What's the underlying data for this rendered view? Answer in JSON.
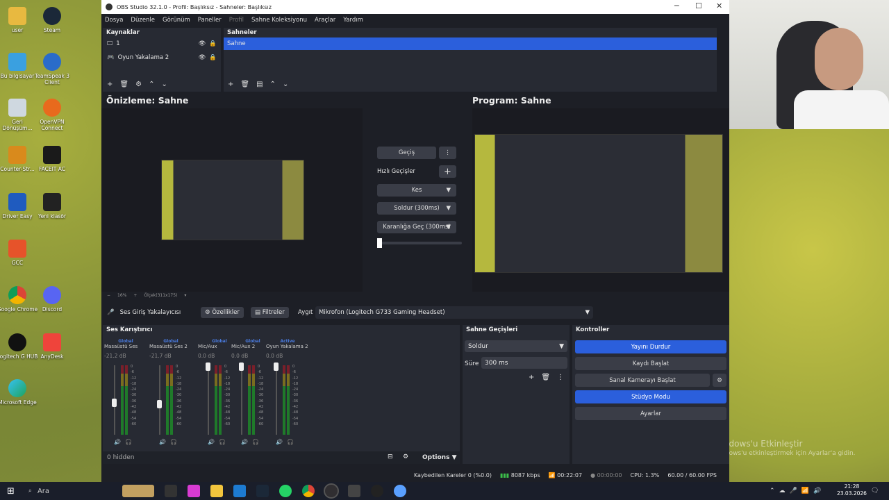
{
  "window": {
    "title": "OBS Studio 32.1.0 - Profil: Başlıksız - Sahneler: Başlıksız",
    "min": "─",
    "max": "☐",
    "close": "✕"
  },
  "menu": [
    "Dosya",
    "Düzenle",
    "Görünüm",
    "Paneller",
    "Profil",
    "Sahne Koleksiyonu",
    "Araçlar",
    "Yardım"
  ],
  "sources": {
    "title": "Kaynaklar",
    "items": [
      {
        "icon": "monitor-icon",
        "label": "1"
      },
      {
        "icon": "gamepad-icon",
        "label": "Oyun Yakalama 2"
      }
    ]
  },
  "scenes": {
    "title": "Sahneler",
    "items": [
      "Sahne"
    ]
  },
  "preview": {
    "title": "Önizleme: Sahne",
    "zoom": "16%",
    "size": "Ölçek(311x175)"
  },
  "program": {
    "title": "Program: Sahne"
  },
  "transitions": {
    "gecis": "Geçiş",
    "quick": "Hızlı Geçişler",
    "cut": "Kes",
    "fade": "Soldur (300ms)",
    "fade_black": "Karanlığa Geç (300ms)"
  },
  "audio_capture": {
    "label": "Ses Giriş Yakalayıcısı",
    "props": "Özellikler",
    "filters": "Filtreler",
    "device_label": "Aygıt",
    "device": "Mikrofon (Logitech G733 Gaming Headset)"
  },
  "mixer": {
    "title": "Ses Karıştırıcı",
    "hidden": "0 hidden",
    "options": "Options",
    "channels": [
      {
        "head": "Global",
        "name": "Masaüstü Ses",
        "db": "-21.2 dB",
        "level": 0.46
      },
      {
        "head": "Global",
        "name": "Masaüstü Ses 2",
        "db": "-21.7 dB",
        "level": 0.44
      },
      {
        "head": "Global",
        "name": "Mic/Aux",
        "db": "0.0 dB",
        "level": 0.98
      },
      {
        "head": "Global",
        "name": "Mic/Aux 2",
        "db": "0.0 dB",
        "level": 0.98
      },
      {
        "head": "Active",
        "name": "Oyun Yakalama 2",
        "db": "0.0 dB",
        "level": 0.98
      }
    ],
    "ticks": [
      "0",
      "-6",
      "-12",
      "-18",
      "-24",
      "-30",
      "-36",
      "-42",
      "-48",
      "-54",
      "-60"
    ]
  },
  "scene_transitions": {
    "title": "Sahne Geçişleri",
    "type": "Soldur",
    "duration_label": "Süre",
    "duration": "300 ms"
  },
  "controls": {
    "title": "Kontroller",
    "stop_stream": "Yayını Durdur",
    "record": "Kaydı Başlat",
    "vcam": "Sanal Kamerayı Başlat",
    "studio": "Stüdyo Modu",
    "settings": "Ayarlar"
  },
  "status": {
    "dropped": "Kaybedilen Kareler 0 (%0.0)",
    "kbps": "8087 kbps",
    "stream_time": "00:22:07",
    "rec_time": "00:00:00",
    "cpu": "CPU: 1.3%",
    "fps": "60.00 / 60.00 FPS"
  },
  "desktop_icons": [
    "user",
    "Steam",
    "Bu bilgisayar",
    "TeamSpeak 3 Client",
    "Geri Dönüşüm...",
    "OpenVPN Connect",
    "Counter-Str...",
    "FACEIT AC",
    "Driver Easy",
    "Yeni klasör",
    "GCC",
    "Google Chrome",
    "Discord",
    "Logitech G HUB",
    "AnyDesk",
    "Microsoft Edge"
  ],
  "watermark": {
    "line1": "Windows'u Etkinleştir",
    "line2": "Windows'u etkinleştirmek için Ayarlar'a gidin."
  },
  "taskbar": {
    "search": "Ara",
    "time": "21:28",
    "date": "23.03.2026"
  },
  "colors": {
    "accent": "#2b5fdc",
    "window_bg": "#1d1f26",
    "panel_bg": "#272a33"
  }
}
